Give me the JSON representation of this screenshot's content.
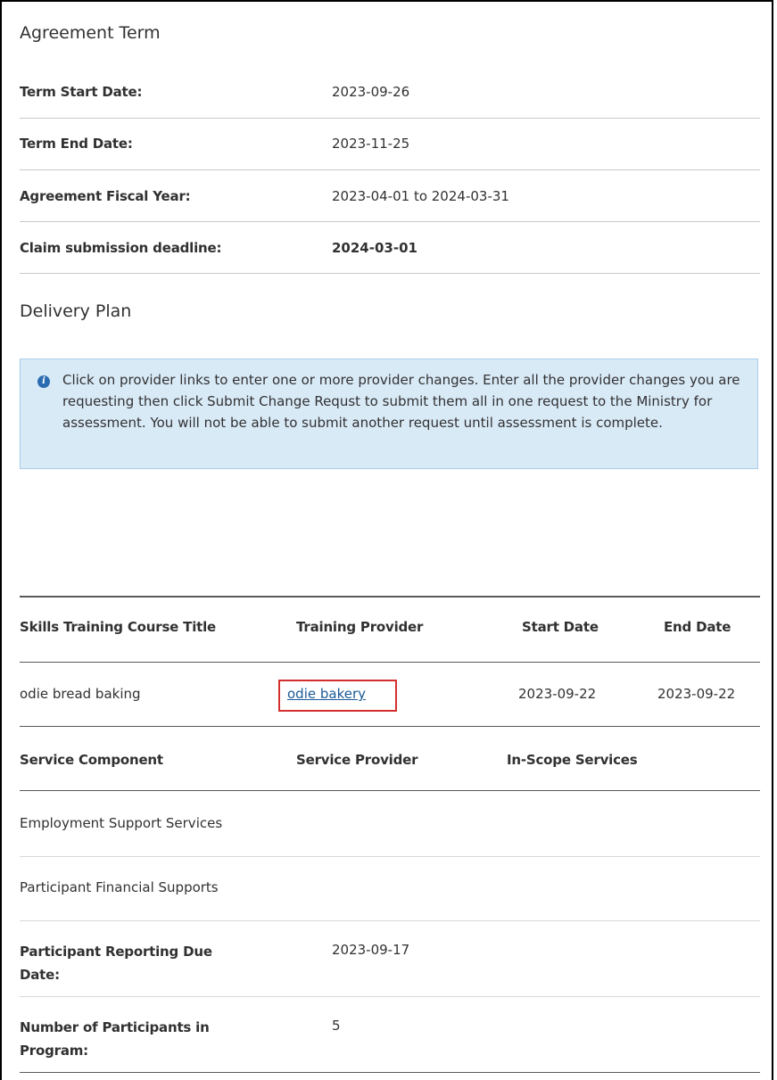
{
  "agreement_term": {
    "title": "Agreement Term",
    "rows": [
      {
        "label": "Term Start Date:",
        "value": "2023-09-26"
      },
      {
        "label": "Term End Date:",
        "value": "2023-11-25"
      },
      {
        "label": "Agreement Fiscal Year:",
        "value": "2023-04-01 to 2024-03-31"
      },
      {
        "label": "Claim submission deadline:",
        "value": "2024-03-01"
      }
    ]
  },
  "delivery_plan": {
    "title": "Delivery Plan",
    "info_icon": "info-circle-icon",
    "info_message": "Click on provider links to enter one or more provider changes. Enter all the provider changes you are requesting then click Submit Change Requst to submit them all in one request to the Ministry for assessment. You will not be able to submit another request until assessment is complete."
  },
  "training_table": {
    "headers": [
      "Skills Training Course Title",
      "Training Provider",
      "Start Date",
      "End Date"
    ],
    "rows": [
      {
        "course_title": "odie bread baking",
        "provider": "odie bakery",
        "start_date": "2023-09-22",
        "end_date": "2023-09-22"
      }
    ]
  },
  "service_table": {
    "headers": [
      "Service Component",
      "Service Provider",
      "In-Scope Services"
    ],
    "rows": [
      {
        "component": "Employment Support Services"
      },
      {
        "component": "Participant Financial Supports"
      }
    ]
  },
  "participants": {
    "reporting_due_label_line1": "Participant Reporting Due",
    "reporting_due_label_line2": "Date:",
    "reporting_due_value": "2023-09-17",
    "count_label_line1": "Number of Participants in",
    "count_label_line2": "Program:",
    "count_value": "5"
  },
  "colors": {
    "info_bg": "#d9eaf7",
    "link": "#1a5a96",
    "highlight_border": "#d32f2f"
  }
}
